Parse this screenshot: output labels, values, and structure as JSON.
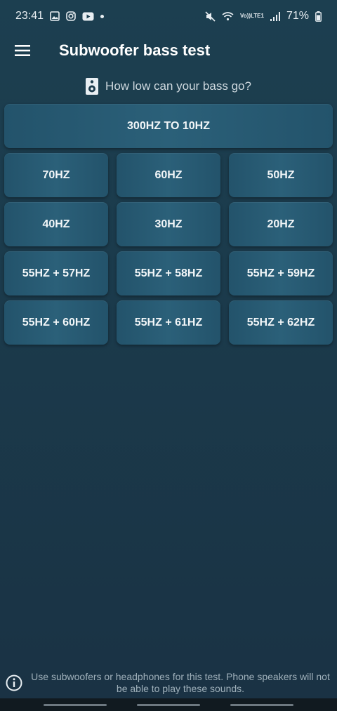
{
  "status_bar": {
    "time": "23:41",
    "battery": "71%",
    "network_label_top": "Vo))",
    "network_label_bottom": "LTE1",
    "icons": [
      "gallery-icon",
      "instagram-icon",
      "youtube-icon",
      "notification-dot",
      "mute-icon",
      "wifi-icon",
      "signal-icon",
      "battery-icon"
    ]
  },
  "app_bar": {
    "title": "Subwoofer bass test",
    "menu_icon": "hamburger-menu-icon"
  },
  "subtitle": {
    "icon": "speaker-icon",
    "text": "How low can your bass go?"
  },
  "buttons": {
    "sweep": "300HZ TO 10HZ",
    "rows": [
      [
        "70HZ",
        "60HZ",
        "50HZ"
      ],
      [
        "40HZ",
        "30HZ",
        "20HZ"
      ],
      [
        "55HZ + 57HZ",
        "55HZ + 58HZ",
        "55HZ + 59HZ"
      ],
      [
        "55HZ + 60HZ",
        "55HZ + 61HZ",
        "55HZ + 62HZ"
      ]
    ]
  },
  "footer": {
    "icon": "info-icon",
    "text": "Use subwoofers or headphones for this test. Phone speakers will not be able to play these sounds."
  },
  "colors": {
    "background": "#1b3a4b",
    "button": "#2b6079",
    "footer_text": "#9fb0ba"
  }
}
